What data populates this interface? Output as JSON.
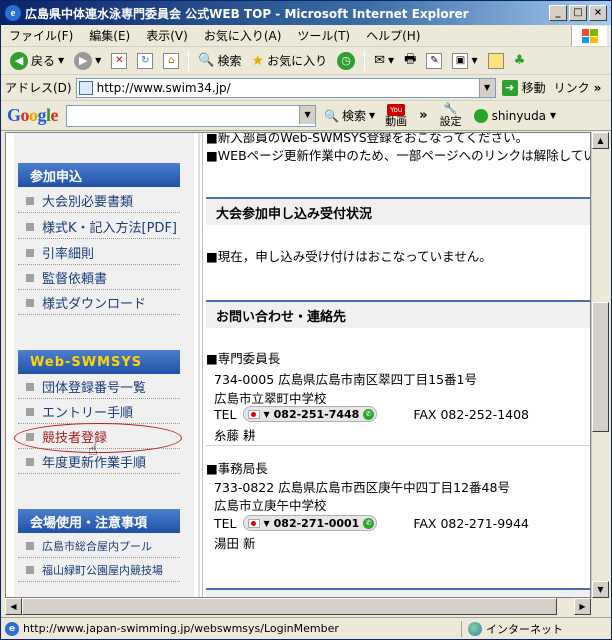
{
  "window": {
    "title": "広島県中体連水泳専門委員会 公式WEB TOP - Microsoft Internet Explorer",
    "controls": [
      "_",
      "□",
      "×"
    ]
  },
  "menubar": [
    "ファイル(F)",
    "編集(E)",
    "表示(V)",
    "お気に入り(A)",
    "ツール(T)",
    "ヘルプ(H)"
  ],
  "toolbar": {
    "back": "戻る",
    "search": "検索",
    "favorites": "お気に入り"
  },
  "address": {
    "label": "アドレス(D)",
    "url": "http://www.swim34.jp/",
    "go": "移動",
    "links": "リンク"
  },
  "google_bar": {
    "logo": "Google",
    "search_label": "検索",
    "video_label": "動画",
    "more": "»",
    "settings_label": "設定",
    "user": "shinyuda"
  },
  "sidebar": {
    "sections": [
      {
        "title": "参加申込",
        "items": [
          "大会別必要書類",
          "様式K・記入方法[PDF]",
          "引率細則",
          "監督依頼書",
          "様式ダウンロード"
        ]
      },
      {
        "title": "Web-SWMSYS",
        "items": [
          "団体登録番号一覧",
          "エントリー手順",
          "競技者登録",
          "年度更新作業手順"
        ]
      },
      {
        "title": "会場使用・注意事項",
        "items": [
          "広島市総合屋内プール",
          "福山緑町公園屋内競技場"
        ]
      }
    ]
  },
  "main": {
    "notice_top": "■新入部員のWeb-SWMSYS登録をおこなってください。",
    "notice_2": "■WEBページ更新作業中のため、一部ページへのリンクは解除していま",
    "entry_status": {
      "title": "大会参加申し込み受付状況",
      "text": "■現在，申し込み受け付けはおこなっていません。"
    },
    "contact": {
      "title": "お問い合わせ・連絡先",
      "people": [
        {
          "role": "■専門委員長",
          "address": "734-0005  広島県広島市南区翠四丁目15番1号",
          "school": "広島市立翠町中学校",
          "tel_label": "TEL",
          "tel": "082-251-7448",
          "fax": "FAX 082-252-1408",
          "name": "糸藤  耕"
        },
        {
          "role": "■事務局長",
          "address": "733-0822  広島県広島市西区庚午中四丁目12番48号",
          "school": "広島市立庚午中学校",
          "tel_label": "TEL",
          "tel": "082-271-0001",
          "fax": "FAX 082-271-9944",
          "name": "湯田  新"
        }
      ]
    }
  },
  "statusbar": {
    "url": "http://www.japan-swimming.jp/webswmsys/LoginMember",
    "zone": "インターネット"
  },
  "colors": {
    "titlebar": "#0a246a",
    "section_header": "#1f52a8",
    "section_header_text_alt": "#ffd700",
    "link": "#1a3c7a",
    "highlight_oval": "#c02020"
  }
}
